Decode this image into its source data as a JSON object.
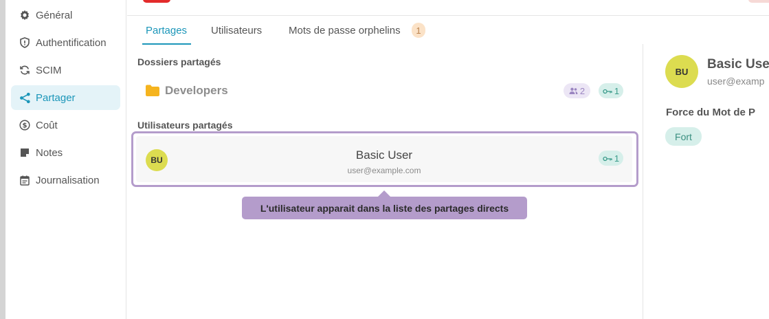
{
  "sidebar": {
    "items": [
      {
        "label": "Général",
        "icon": "gear-icon"
      },
      {
        "label": "Authentification",
        "icon": "shield-icon"
      },
      {
        "label": "SCIM",
        "icon": "sync-icon"
      },
      {
        "label": "Partager",
        "icon": "share-icon",
        "active": true
      },
      {
        "label": "Coût",
        "icon": "dollar-icon"
      },
      {
        "label": "Notes",
        "icon": "note-icon"
      },
      {
        "label": "Journalisation",
        "icon": "calendar-icon"
      }
    ]
  },
  "tabs": [
    {
      "label": "Partages",
      "active": true
    },
    {
      "label": "Utilisateurs"
    },
    {
      "label": "Mots de passe orphelins",
      "badge": "1"
    }
  ],
  "shared_folders": {
    "title": "Dossiers partagés",
    "items": [
      {
        "name": "Developers",
        "members": "2",
        "passwords": "1"
      }
    ]
  },
  "shared_users": {
    "title": "Utilisateurs partagés",
    "items": [
      {
        "initials": "BU",
        "name": "Basic User",
        "email": "user@example.com",
        "passwords": "1"
      }
    ]
  },
  "tooltip": "L'utilisateur apparait dans la liste des partages directs",
  "detail": {
    "initials": "BU",
    "name": "Basic Use",
    "email": "user@examp",
    "strength_title": "Force du Mot de P",
    "strength_value": "Fort"
  },
  "colors": {
    "accent": "#1b96b9",
    "highlight": "#b49ccb",
    "avatar": "#dcdc50",
    "danger": "#e32b2b"
  }
}
